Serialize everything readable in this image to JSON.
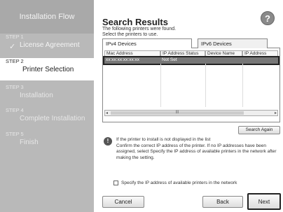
{
  "sidebar": {
    "header": "Installation Flow",
    "steps": [
      {
        "num": "STEP 1",
        "name": "License Agreement",
        "check": "✓"
      },
      {
        "num": "STEP 2",
        "name": "Printer Selection"
      },
      {
        "num": "STEP 3",
        "name": "Installation"
      },
      {
        "num": "STEP 4",
        "name": "Complete Installation"
      },
      {
        "num": "STEP 5",
        "name": "Finish"
      }
    ]
  },
  "main": {
    "title": "Search Results",
    "subtitle1": "The following printers were found.",
    "subtitle2": "Select the printers to use.",
    "help_glyph": "?",
    "tabs": [
      {
        "label": "IPv4 Devices"
      },
      {
        "label": "IPv6 Devices"
      }
    ],
    "table": {
      "columns": [
        "Mac Address",
        "IP Address Status",
        "Device Name",
        "IP Address"
      ],
      "rows": [
        {
          "mac": "xx:xx:xx:xx:xx:xx",
          "status": "Not Set",
          "device": "",
          "ip": ""
        }
      ]
    },
    "scroll_label": "III",
    "search_again": "Search Again",
    "info_icon": "!",
    "info_text": "If the printer to install is not displayed in the list\nConfirm the correct IP address of the printer. If no IP addresses have been assigned, select Specify the IP address of available printers in the network after making the setting.",
    "checkbox_label": "Specify the IP address of available printers in the network",
    "buttons": {
      "cancel": "Cancel",
      "back": "Back",
      "next": "Next"
    }
  }
}
